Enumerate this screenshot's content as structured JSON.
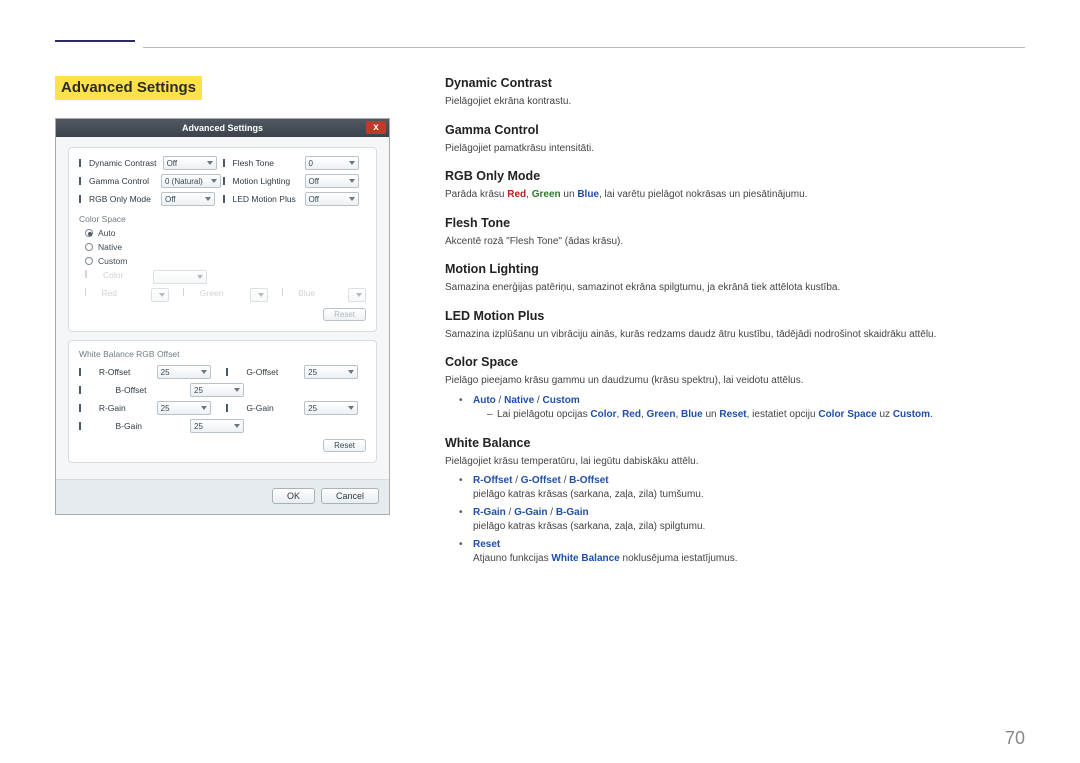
{
  "page": {
    "section_title": "Advanced Settings",
    "page_number": "70"
  },
  "dialog": {
    "title": "Advanced Settings",
    "close": "x",
    "top_panel": {
      "dynamic_contrast": {
        "label": "Dynamic Contrast",
        "value": "Off"
      },
      "gamma_control": {
        "label": "Gamma Control",
        "value": "0 (Natural)"
      },
      "rgb_only_mode": {
        "label": "RGB Only Mode",
        "value": "Off"
      },
      "flesh_tone": {
        "label": "Flesh Tone",
        "value": "0"
      },
      "motion_lighting": {
        "label": "Motion Lighting",
        "value": "Off"
      },
      "led_motion_plus": {
        "label": "LED Motion Plus",
        "value": "Off"
      }
    },
    "color_space": {
      "title": "Color Space",
      "opt_auto": "Auto",
      "opt_native": "Native",
      "opt_custom": "Custom",
      "dcolor": "Color",
      "dred": "Red",
      "dgreen": "Green",
      "dblue": "Blue",
      "reset": "Reset"
    },
    "white_balance": {
      "title": "White Balance RGB Offset",
      "r_offset": {
        "label": "R-Offset",
        "value": "25"
      },
      "g_offset": {
        "label": "G-Offset",
        "value": "25"
      },
      "b_offset": {
        "label": "B-Offset",
        "value": "25"
      },
      "r_gain": {
        "label": "R-Gain",
        "value": "25"
      },
      "g_gain": {
        "label": "G-Gain",
        "value": "25"
      },
      "b_gain": {
        "label": "B-Gain",
        "value": "25"
      },
      "reset": "Reset"
    },
    "footer": {
      "ok": "OK",
      "cancel": "Cancel"
    }
  },
  "desc": {
    "dc_h": "Dynamic Contrast",
    "dc_p": "Pielāgojiet ekrāna kontrastu.",
    "gc_h": "Gamma Control",
    "gc_p": "Pielāgojiet pamatkrāsu intensitāti.",
    "rgb_h": "RGB Only Mode",
    "rgb_p_pre": "Parāda krāsu ",
    "rgb_red": "Red",
    "rgb_sep1": ", ",
    "rgb_green": "Green",
    "rgb_sep2": " un ",
    "rgb_blue": "Blue",
    "rgb_p_post": ", lai varētu pielāgot nokrāsas un piesātinājumu.",
    "ft_h": "Flesh Tone",
    "ft_p": "Akcentē rozā \"Flesh Tone\" (ādas krāsu).",
    "ml_h": "Motion Lighting",
    "ml_p": "Samazina enerģijas patēriņu, samazinot ekrāna spilgtumu, ja ekrānā tiek attēlota kustība.",
    "lmp_h": "LED Motion Plus",
    "lmp_p": "Samazina izplūšanu un vibrāciju ainās, kurās redzams daudz ātru kustību, tādējādi nodrošinot skaidrāku attēlu.",
    "cs_h": "Color Space",
    "cs_p": "Pielāgo pieejamo krāsu gammu un daudzumu (krāsu spektru), lai veidotu attēlus.",
    "cs_b1_auto": "Auto",
    "cs_b1_sep": " / ",
    "cs_b1_native": "Native",
    "cs_b1_custom": "Custom",
    "cs_sub_pre": "Lai pielāgotu opcijas ",
    "cs_sub_color": "Color",
    "cs_sub_s1": ", ",
    "cs_sub_red": "Red",
    "cs_sub_s2": ", ",
    "cs_sub_green": "Green",
    "cs_sub_s3": ", ",
    "cs_sub_blue": "Blue",
    "cs_sub_s4": " un ",
    "cs_sub_reset": "Reset",
    "cs_sub_mid": ", iestatiet opciju ",
    "cs_sub_cs": "Color Space",
    "cs_sub_s5": " uz ",
    "cs_sub_custom": "Custom",
    "cs_sub_end": ".",
    "wb_h": "White Balance",
    "wb_p": "Pielāgojiet krāsu temperatūru, lai iegūtu dabiskāku attēlu.",
    "wb_l1_ro": "R-Offset",
    "wb_sep": " / ",
    "wb_l1_go": "G-Offset",
    "wb_l1_bo": "B-Offset",
    "wb_l1_d": "pielāgo katras krāsas (sarkana, zaļa, zila) tumšumu.",
    "wb_l2_rg": "R-Gain",
    "wb_l2_gg": "G-Gain",
    "wb_l2_bg": "B-Gain",
    "wb_l2_d": "pielāgo katras krāsas (sarkana, zaļa, zila) spilgtumu.",
    "wb_l3_reset": "Reset",
    "wb_l3_d_pre": "Atjauno funkcijas ",
    "wb_l3_d_wb": "White Balance",
    "wb_l3_d_post": " noklusējuma iestatījumus."
  }
}
